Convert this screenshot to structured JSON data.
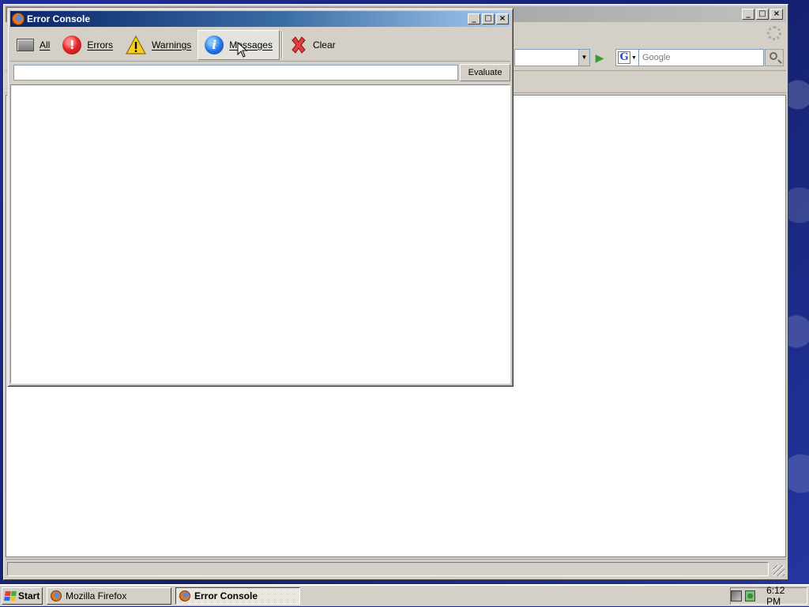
{
  "firefox": {
    "search_placeholder": "Google",
    "search_engine_letter": "G"
  },
  "console": {
    "title": "Error Console",
    "toolbar": {
      "all": "All",
      "errors": "Errors",
      "warnings": "Warnings",
      "messages": "Messages",
      "clear": "Clear"
    },
    "active_tab": "messages",
    "eval_value": "",
    "eval_button": "Evaluate"
  },
  "window_controls": {
    "minimize": "_",
    "maximize": "□",
    "close": "×"
  },
  "taskbar": {
    "start": "Start",
    "tasks": [
      "Mozilla Firefox",
      "Error Console"
    ],
    "active_task": "Error Console",
    "clock": "6:12 PM"
  },
  "colors": {
    "titlebar_active_start": "#0a246a",
    "titlebar_active_end": "#a6caf0",
    "desktop": "#1a2a86",
    "chrome": "#d4d0c8"
  }
}
